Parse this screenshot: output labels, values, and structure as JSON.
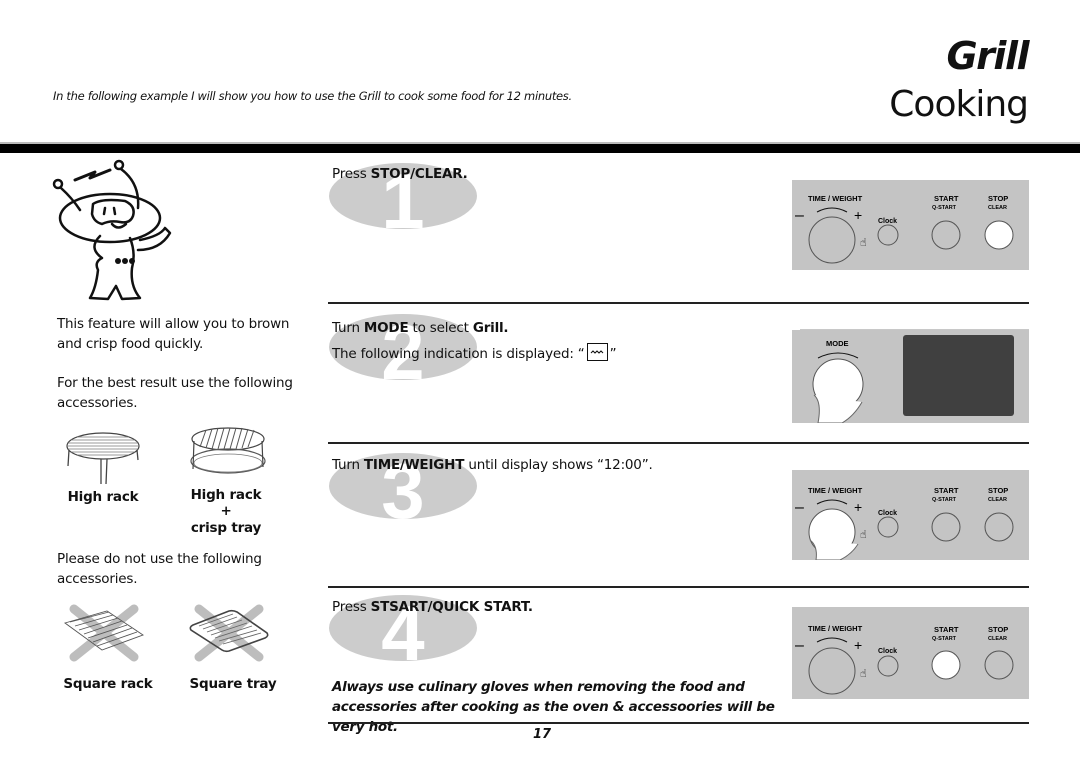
{
  "header": {
    "intro": "In the following example I will show you how to use the Grill to cook some food for 12 minutes.",
    "title_line1": "Grill",
    "title_line2": "Cooking"
  },
  "left": {
    "feature_text": "This feature will allow you to brown and crisp food quickly.",
    "best_result_text": "For the best result use the following accessories.",
    "recommended_accessories": [
      {
        "label": "High rack",
        "icon": "high-rack-icon"
      },
      {
        "label_line1": "High rack",
        "label_line2": "+",
        "label_line3": "crisp tray",
        "icon": "high-rack-crisp-tray-icon"
      }
    ],
    "do_not_use_text": "Please do not use the following accessories.",
    "forbidden_accessories": [
      {
        "label": "Square rack",
        "icon": "square-rack-crossed-icon"
      },
      {
        "label": "Square tray",
        "icon": "square-tray-crossed-icon"
      }
    ]
  },
  "steps": [
    {
      "number": "1",
      "prefix": "Press ",
      "bold": "STOP/CLEAR.",
      "panel": {
        "dial_label": "TIME / WEIGHT",
        "minus": "–",
        "plus": "+",
        "clock_label": "Clock",
        "start_label": "START",
        "start_sub": "Q-START",
        "stop_label": "STOP",
        "stop_sub": "CLEAR",
        "highlighted": "stop"
      }
    },
    {
      "number": "2",
      "prefix": "Turn ",
      "bold": "MODE",
      "middle": " to select ",
      "bold2": "Grill.",
      "line2_prefix": "The following indication is displayed: “",
      "line2_suffix": "”",
      "indicator_icon": "grill-wave-icon",
      "indicator_glyph": "〰",
      "panel": {
        "dial_label": "MODE"
      }
    },
    {
      "number": "3",
      "prefix": "Turn ",
      "bold": "TIME/WEIGHT",
      "suffix": " until display shows “12:00”.",
      "panel": {
        "dial_label": "TIME / WEIGHT",
        "minus": "–",
        "plus": "+",
        "clock_label": "Clock",
        "start_label": "START",
        "start_sub": "Q-START",
        "stop_label": "STOP",
        "stop_sub": "CLEAR",
        "highlighted": "dial"
      }
    },
    {
      "number": "4",
      "prefix": "Press ",
      "bold": "STSART/QUICK START.",
      "panel": {
        "dial_label": "TIME / WEIGHT",
        "minus": "–",
        "plus": "+",
        "clock_label": "Clock",
        "start_label": "START",
        "start_sub": "Q-START",
        "stop_label": "STOP",
        "stop_sub": "CLEAR",
        "highlighted": "start"
      }
    }
  ],
  "warning": "Always use culinary gloves when removing the food and accessories after cooking as the oven & accessoories will be very hot.",
  "page_number": "17",
  "colors": {
    "panel": "#c4c4c4",
    "badge": "#cccccc",
    "display": "#404040",
    "rule": "#222222"
  }
}
